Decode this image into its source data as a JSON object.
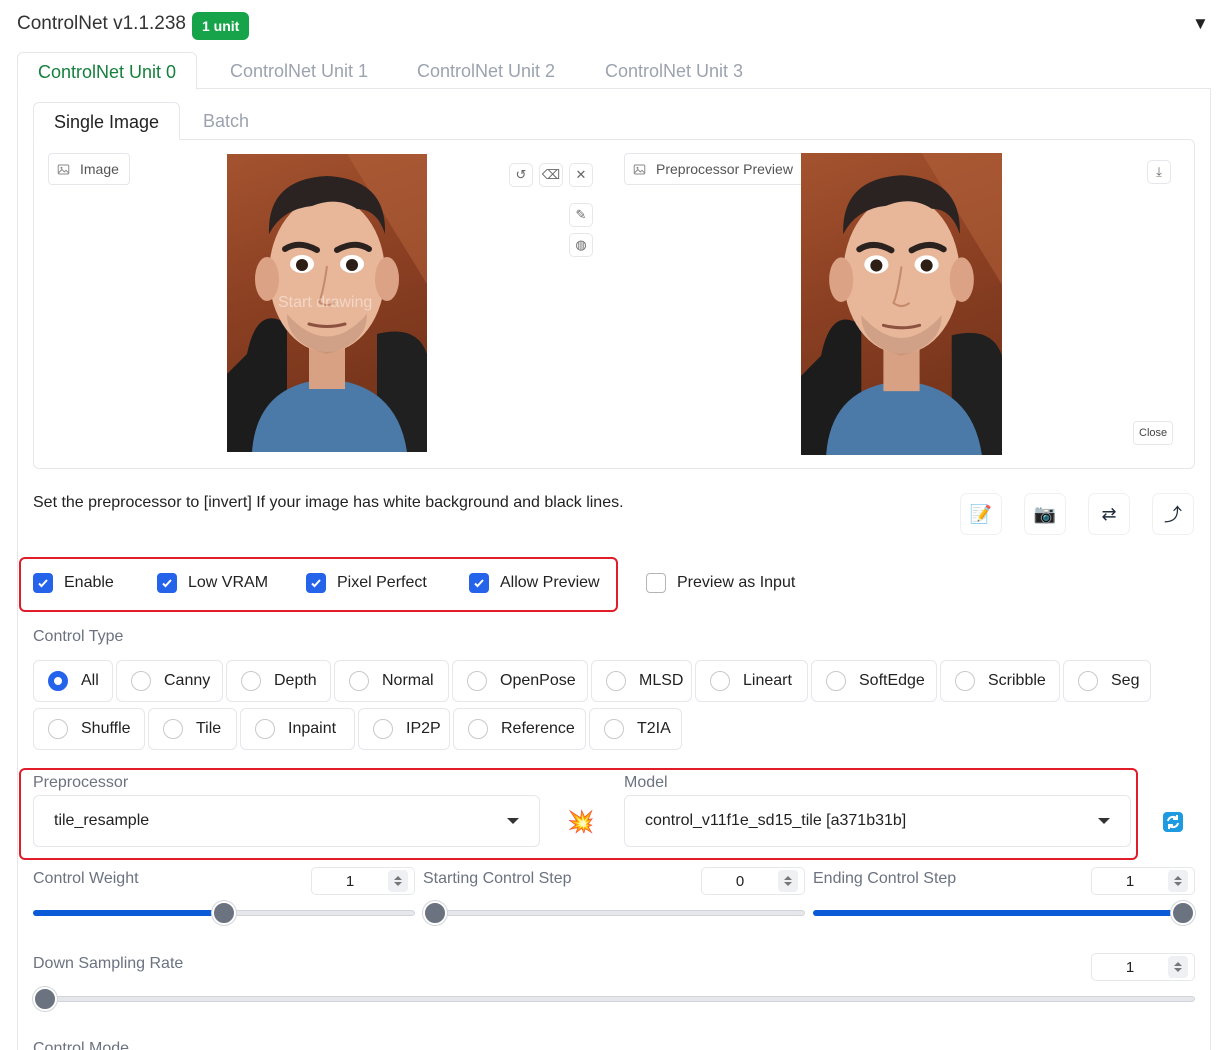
{
  "header": {
    "title": "ControlNet v1.1.238",
    "badge": "1 unit"
  },
  "unit_tabs": [
    "ControlNet Unit 0",
    "ControlNet Unit 1",
    "ControlNet Unit 2",
    "ControlNet Unit 3"
  ],
  "sub_tabs": [
    "Single Image",
    "Batch"
  ],
  "image_panel": {
    "label": "Image",
    "overlay": "Start drawing"
  },
  "preview_panel": {
    "label": "Preprocessor Preview",
    "close": "Close"
  },
  "hint": "Set the preprocessor to [invert] If your image has white background and black lines.",
  "checkboxes": [
    {
      "label": "Enable",
      "checked": true
    },
    {
      "label": "Low VRAM",
      "checked": true
    },
    {
      "label": "Pixel Perfect",
      "checked": true
    },
    {
      "label": "Allow Preview",
      "checked": true
    },
    {
      "label": "Preview as Input",
      "checked": false
    }
  ],
  "control_type": {
    "label": "Control Type",
    "selected": "All",
    "options": [
      "All",
      "Canny",
      "Depth",
      "Normal",
      "OpenPose",
      "MLSD",
      "Lineart",
      "SoftEdge",
      "Scribble",
      "Seg",
      "Shuffle",
      "Tile",
      "Inpaint",
      "IP2P",
      "Reference",
      "T2IA"
    ]
  },
  "preprocessor": {
    "label": "Preprocessor",
    "value": "tile_resample"
  },
  "model": {
    "label": "Model",
    "value": "control_v11f1e_sd15_tile [a371b31b]"
  },
  "control_weight": {
    "label": "Control Weight",
    "value": "1",
    "fraction": 0.5
  },
  "starting_step": {
    "label": "Starting Control Step",
    "value": "0",
    "fraction": 0.0
  },
  "ending_step": {
    "label": "Ending Control Step",
    "value": "1",
    "fraction": 1.0
  },
  "down_sampling": {
    "label": "Down Sampling Rate",
    "value": "1",
    "fraction": 0.0
  },
  "control_mode": {
    "label": "Control Mode"
  },
  "colors": {
    "accent": "#2563eb",
    "green": "#16a34a",
    "highlight": "#e11d2a"
  }
}
